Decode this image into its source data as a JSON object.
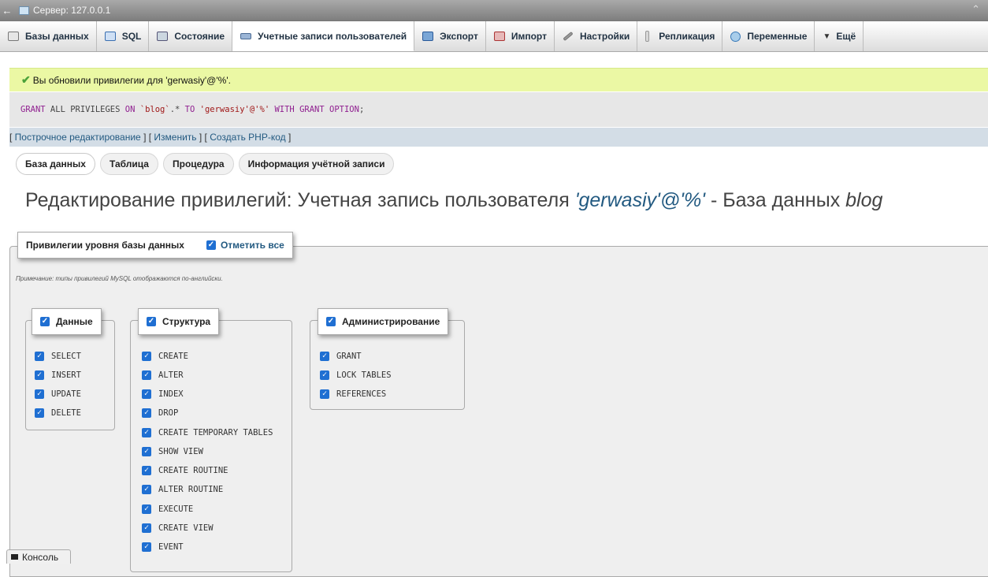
{
  "server_bar": {
    "label": "Сервер: 127.0.0.1"
  },
  "tabs": [
    {
      "label": "Базы данных",
      "icon": "database-icon"
    },
    {
      "label": "SQL",
      "icon": "sql-icon"
    },
    {
      "label": "Состояние",
      "icon": "status-icon"
    },
    {
      "label": "Учетные записи пользователей",
      "icon": "users-icon",
      "active": true
    },
    {
      "label": "Экспорт",
      "icon": "export-icon"
    },
    {
      "label": "Импорт",
      "icon": "import-icon"
    },
    {
      "label": "Настройки",
      "icon": "wrench-icon"
    },
    {
      "label": "Репликация",
      "icon": "replication-icon"
    },
    {
      "label": "Переменные",
      "icon": "variables-icon"
    },
    {
      "label": "Ещё",
      "icon": "triangle-down-icon"
    }
  ],
  "success": {
    "message": "Вы обновили привилегии для 'gerwasiy'@'%'."
  },
  "sql": {
    "grant": "GRANT",
    "all_priv": " ALL PRIVILEGES ",
    "on": "ON",
    "db": " `blog`",
    "star": ".* ",
    "to": "TO",
    "user": " 'gerwasiy'@'%' ",
    "with": "WITH GRANT OPTION",
    "end": ";"
  },
  "sql_links": {
    "open": "[ ",
    "inline": "Построчное редактирование",
    "sep1": " ] [ ",
    "edit": "Изменить",
    "sep2": " ] [ ",
    "php": "Создать PHP-код",
    "close": " ]"
  },
  "subtabs": [
    "База данных",
    "Таблица",
    "Процедура",
    "Информация учётной записи"
  ],
  "title": {
    "prefix": "Редактирование привилегий: Учетная запись пользователя ",
    "user": "'gerwasiy'@'%'",
    "mid": " - База данных ",
    "db": "blog"
  },
  "privileges": {
    "legend": "Привилегии уровня базы данных",
    "select_all": "Отметить все",
    "note": "Примечание: типы привилегий MySQL отображаются по-английски.",
    "groups": [
      {
        "name": "Данные",
        "items": [
          "SELECT",
          "INSERT",
          "UPDATE",
          "DELETE"
        ]
      },
      {
        "name": "Структура",
        "items": [
          "CREATE",
          "ALTER",
          "INDEX",
          "DROP",
          "CREATE TEMPORARY TABLES",
          "SHOW VIEW",
          "CREATE ROUTINE",
          "ALTER ROUTINE",
          "EXECUTE",
          "CREATE VIEW",
          "EVENT"
        ]
      },
      {
        "name": "Администрирование",
        "items": [
          "GRANT",
          "LOCK TABLES",
          "REFERENCES"
        ]
      }
    ]
  },
  "console": {
    "label": "Консоль"
  },
  "colors": {
    "accent": "#235a81",
    "success_bg": "#ebf8a4",
    "checkbox": "#1f6fd2"
  }
}
